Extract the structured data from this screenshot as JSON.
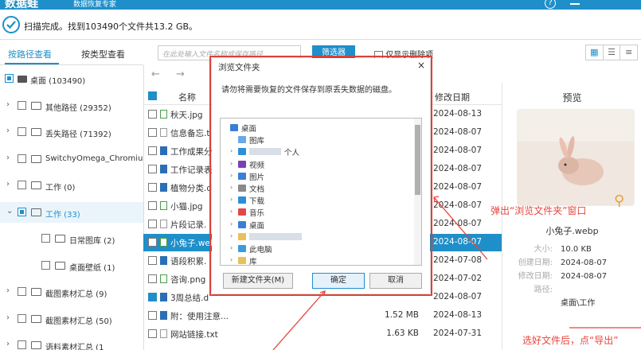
{
  "app": {
    "logo": "数据蛙",
    "subtitle": "数据恢复专家",
    "help": "?"
  },
  "status": {
    "text": "扫描完成。找到103490个文件共13.2 GB。"
  },
  "tabs": [
    {
      "label": "按路径查看",
      "active": true
    },
    {
      "label": "按类型查看",
      "active": false
    }
  ],
  "toolbar": {
    "search_placeholder": "在此处输入文件名称或保存路径",
    "filter_label": "筛选器",
    "show_deleted_label": "仅显示删除项",
    "view_icons": [
      "grid-icon",
      "list-icon",
      "detail-icon"
    ]
  },
  "tree": [
    {
      "label": "桌面 (103490)",
      "level": 0,
      "arrow": "",
      "check": "part",
      "icon": "drive"
    },
    {
      "label": "其他路径 (29352)",
      "level": 0,
      "arrow": "›",
      "check": "off",
      "icon": "folder"
    },
    {
      "label": "丢失路径 (71392)",
      "level": 0,
      "arrow": "›",
      "check": "off",
      "icon": "folder"
    },
    {
      "label": "SwitchyOmega_Chromium",
      "level": 0,
      "arrow": "›",
      "check": "off",
      "icon": "folder"
    },
    {
      "label": "工作 (0)",
      "level": 0,
      "arrow": "›",
      "check": "off",
      "icon": "folder"
    },
    {
      "label": "工作 (33)",
      "level": 0,
      "arrow": "⌄",
      "check": "part",
      "icon": "folder",
      "selected": true
    },
    {
      "label": "日常图库 (2)",
      "level": 1,
      "arrow": "",
      "check": "off",
      "icon": "folder"
    },
    {
      "label": "桌面壁纸 (1)",
      "level": 1,
      "arrow": "",
      "check": "off",
      "icon": "folder"
    },
    {
      "label": "截图素材汇总 (9)",
      "level": 0,
      "arrow": "›",
      "check": "off",
      "icon": "folder"
    },
    {
      "label": "截图素材汇总 (50)",
      "level": 0,
      "arrow": "›",
      "check": "off",
      "icon": "folder"
    },
    {
      "label": "语料素材汇总 (1",
      "level": 0,
      "arrow": "›",
      "check": "off",
      "icon": "folder"
    }
  ],
  "list": {
    "col_name": "名称",
    "col_date": "修改日期",
    "files": [
      {
        "name": "秋天.jpg",
        "size": "",
        "date": "2024-08-13",
        "type": "img",
        "checked": false
      },
      {
        "name": "信息备忘.t",
        "size": "",
        "date": "2024-08-07",
        "type": "txt",
        "checked": false
      },
      {
        "name": "工作成果分",
        "size": "",
        "date": "2024-08-07",
        "type": "doc",
        "checked": false
      },
      {
        "name": "工作记录表",
        "size": "",
        "date": "2024-08-07",
        "type": "doc",
        "checked": false
      },
      {
        "name": "植物分类.d",
        "size": "",
        "date": "2024-08-07",
        "type": "doc",
        "checked": false
      },
      {
        "name": "小猫.jpg",
        "size": "",
        "date": "2024-08-07",
        "type": "img",
        "checked": false
      },
      {
        "name": "片段记录.",
        "size": "",
        "date": "2024-08-07",
        "type": "txt",
        "checked": false
      },
      {
        "name": "小兔子.web",
        "size": "",
        "date": "2024-08-07",
        "type": "img",
        "checked": false,
        "selected": true
      },
      {
        "name": "语段积累.",
        "size": "",
        "date": "2024-07-08",
        "type": "doc",
        "checked": false
      },
      {
        "name": "咨询.png",
        "size": "",
        "date": "2024-07-02",
        "type": "img",
        "checked": false
      },
      {
        "name": "3周总结.d",
        "size": "",
        "date": "2024-08-07",
        "type": "doc",
        "checked": true
      },
      {
        "name": "附：使用注意...",
        "size": "1.52 MB",
        "date": "2024-08-13",
        "type": "doc",
        "checked": false
      },
      {
        "name": "网站链接.txt",
        "size": "1.63 KB",
        "date": "2024-07-31",
        "type": "txt",
        "checked": false
      }
    ]
  },
  "preview": {
    "title": "预览",
    "filename": "小兔子.webp",
    "props": [
      {
        "key": "大小:",
        "value": "10.0 KB"
      },
      {
        "key": "创建日期:",
        "value": "2024-08-07"
      },
      {
        "key": "修改日期:",
        "value": "2024-08-07"
      },
      {
        "key": "路径:",
        "value": ""
      },
      {
        "key": "",
        "value": "桌面\\工作"
      }
    ]
  },
  "dialog": {
    "title": "浏览文件夹",
    "close": "×",
    "message": "请勿将需要恢复的文件保存到原丢失数据的磁盘。",
    "tree": [
      {
        "label": "桌面",
        "level": 0,
        "arrow": "",
        "color": "#3a7fd5",
        "blurred": false
      },
      {
        "label": "图库",
        "level": 1,
        "arrow": "",
        "color": "#6aa8e8",
        "blurred": false
      },
      {
        "label": "个人",
        "level": 1,
        "arrow": "›",
        "color": "#2d8fd6",
        "blurred": true
      },
      {
        "label": "视频",
        "level": 1,
        "arrow": "›",
        "color": "#7b3fb5",
        "blurred": false
      },
      {
        "label": "图片",
        "level": 1,
        "arrow": "›",
        "color": "#3a7fd5",
        "blurred": false
      },
      {
        "label": "文档",
        "level": 1,
        "arrow": "›",
        "color": "#8a8a8a",
        "blurred": false
      },
      {
        "label": "下载",
        "level": 1,
        "arrow": "›",
        "color": "#2d8fd6",
        "blurred": false
      },
      {
        "label": "音乐",
        "level": 1,
        "arrow": "›",
        "color": "#e04848",
        "blurred": false
      },
      {
        "label": "桌面",
        "level": 1,
        "arrow": "›",
        "color": "#3a7fd5",
        "blurred": false
      },
      {
        "label": "",
        "level": 1,
        "arrow": "›",
        "color": "#e8c15a",
        "blurred": true
      },
      {
        "label": "此电脑",
        "level": 1,
        "arrow": "›",
        "color": "#3a9be0",
        "blurred": false
      },
      {
        "label": "库",
        "level": 1,
        "arrow": "›",
        "color": "#e8c15a",
        "blurred": false
      }
    ],
    "new_folder": "新建文件夹(M)",
    "ok": "确定",
    "cancel": "取消"
  },
  "annotations": {
    "popup_note": "弹出“浏览文件夹”窗口",
    "export_note": "选好文件后，点“导出”"
  },
  "colors": {
    "accent": "#1f8fc9",
    "annotation": "#e8453c"
  }
}
